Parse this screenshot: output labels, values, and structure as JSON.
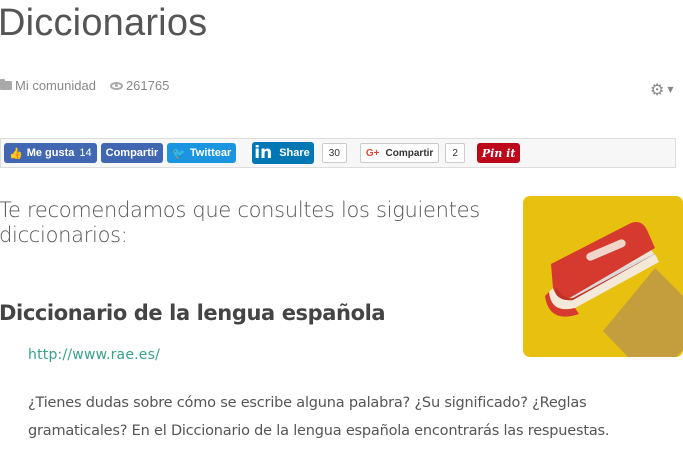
{
  "page": {
    "title": "Diccionarios",
    "category": "Mi comunidad",
    "views": "261765"
  },
  "share": {
    "facebook_like": "Me gusta",
    "facebook_like_count": "14",
    "facebook_share": "Compartir",
    "twitter": "Twittear",
    "linkedin_logo": "in",
    "linkedin": "Share",
    "linkedin_count": "30",
    "google_logo": "G+",
    "google": "Compartir",
    "google_count": "2",
    "pinterest": "Pin it"
  },
  "content": {
    "intro": "Te recomendamos que consultes los siguientes diccionarios:",
    "section_title": "Diccionario de la lengua española",
    "link": "http://www.rae.es/",
    "description": "¿Tienes dudas sobre cómo se escribe alguna palabra? ¿Su significado? ¿Reglas gramaticales? En el Diccionario de la lengua española encontrarás las respuestas."
  },
  "icons": {
    "folder": "folder-icon",
    "views": "eye-icon",
    "settings": "gear-icon",
    "illustration": "book-icon"
  },
  "colors": {
    "facebook": "#4267b2",
    "twitter": "#1b95e0",
    "linkedin": "#0077b5",
    "pinterest": "#bd081c",
    "link": "#39a08a",
    "illustration_bg": "#e8c110",
    "book_red": "#d63a2f"
  }
}
